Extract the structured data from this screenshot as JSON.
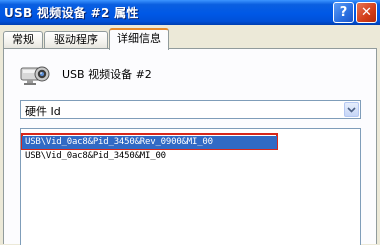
{
  "window": {
    "title": "USB 视频设备 #2 属性",
    "help_label": "?",
    "close_label": "✕"
  },
  "tabs": [
    {
      "label": "常规",
      "active": false
    },
    {
      "label": "驱动程序",
      "active": false
    },
    {
      "label": "详细信息",
      "active": true
    }
  ],
  "device": {
    "icon": "webcam-icon",
    "name": "USB 视频设备 #2"
  },
  "property_select": {
    "selected": "硬件 Id"
  },
  "values": [
    "USB\\Vid_0ac8&Pid_3450&Rev_0900&MI_00",
    "USB\\Vid_0ac8&Pid_3450&MI_00"
  ],
  "colors": {
    "titlebar": "#0054e3",
    "selection": "#316ac5",
    "highlight_box": "#d8271a",
    "active_tab_accent": "#e68b2c"
  }
}
